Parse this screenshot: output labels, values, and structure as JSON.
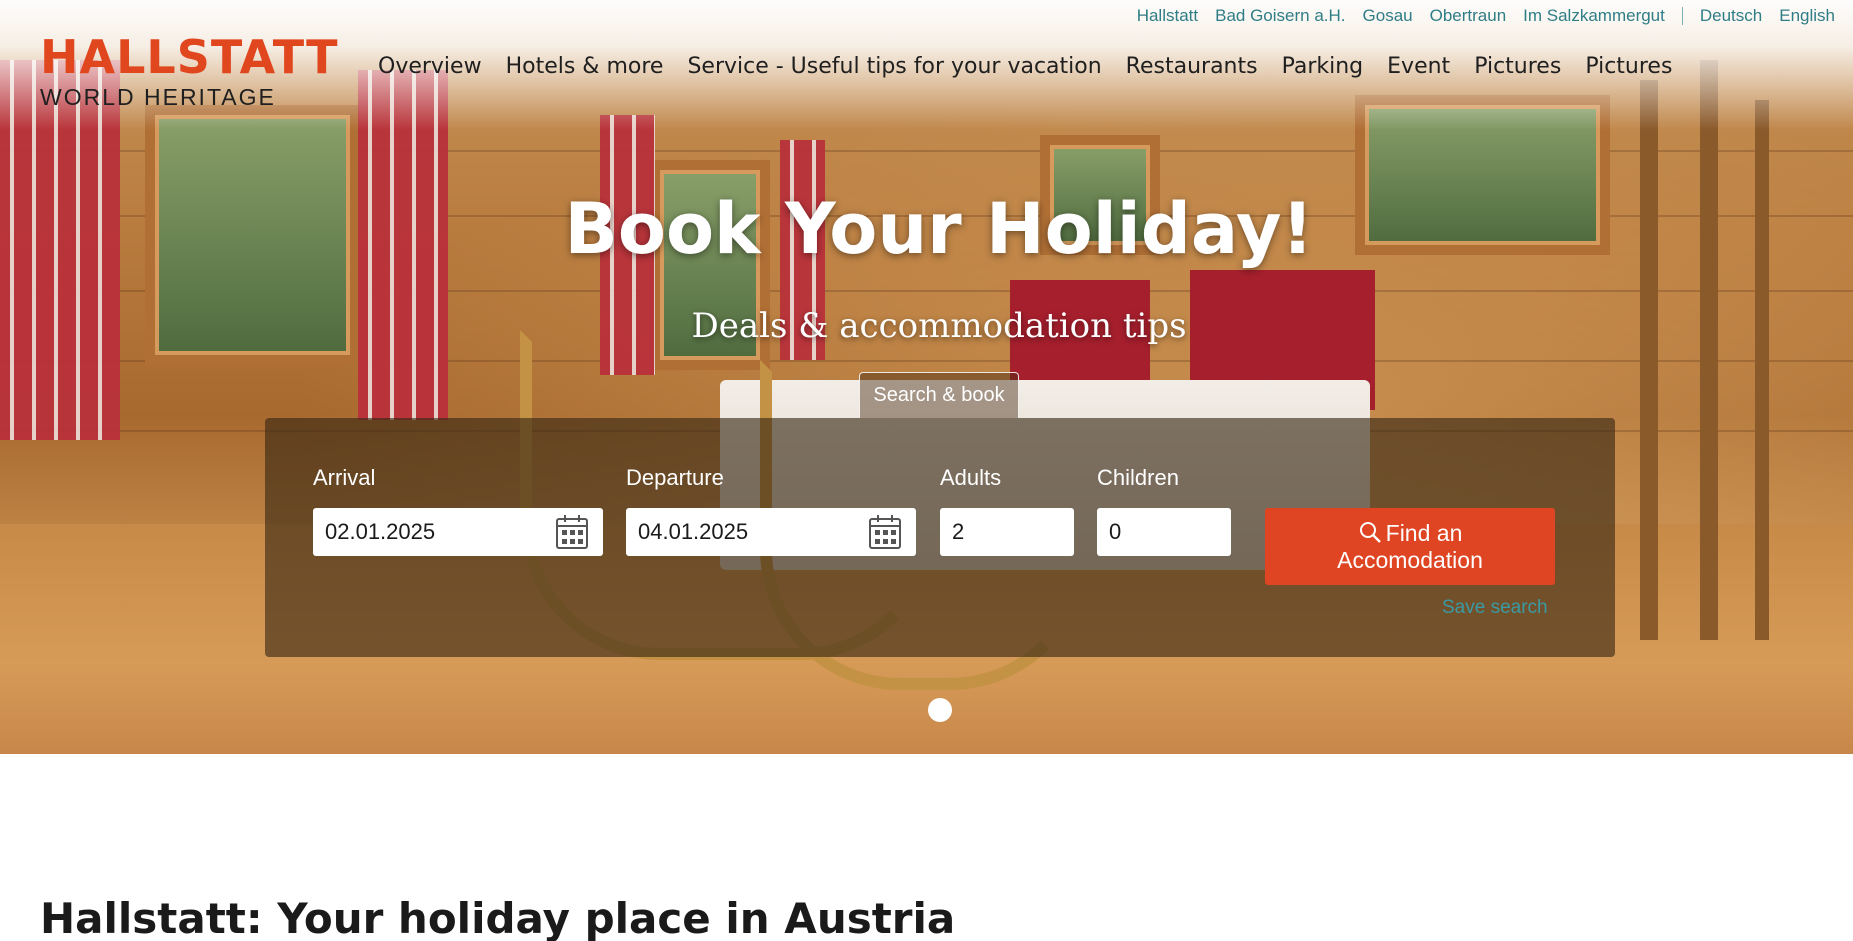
{
  "utility_nav": {
    "links": [
      "Hallstatt",
      "Bad Goisern a.H.",
      "Gosau",
      "Obertraun",
      "Im Salzkammergut"
    ],
    "languages": [
      "Deutsch",
      "English"
    ]
  },
  "logo": {
    "line1": "HALLSTATT",
    "line2": "WORLD HERITAGE"
  },
  "main_nav": {
    "items": [
      "Overview",
      "Hotels & more",
      "Service - Useful tips for your vacation",
      "Restaurants",
      "Parking",
      "Event",
      "Pictures",
      "Pictures"
    ]
  },
  "hero": {
    "title": "Book Your Holiday!",
    "subtitle": "Deals & accommodation tips",
    "tab_label": "Search & book"
  },
  "booking": {
    "arrival_label": "Arrival",
    "arrival_value": "02.01.2025",
    "departure_label": "Departure",
    "departure_value": "04.01.2025",
    "adults_label": "Adults",
    "adults_value": "2",
    "children_label": "Children",
    "children_value": "0",
    "find_button": "Find an Accomodation",
    "save_search": "Save search"
  },
  "page": {
    "heading": "Hallstatt: Your holiday place in Austria"
  },
  "colors": {
    "brand": "#e0471f",
    "link": "#2f7d86",
    "button": "#df4522"
  }
}
